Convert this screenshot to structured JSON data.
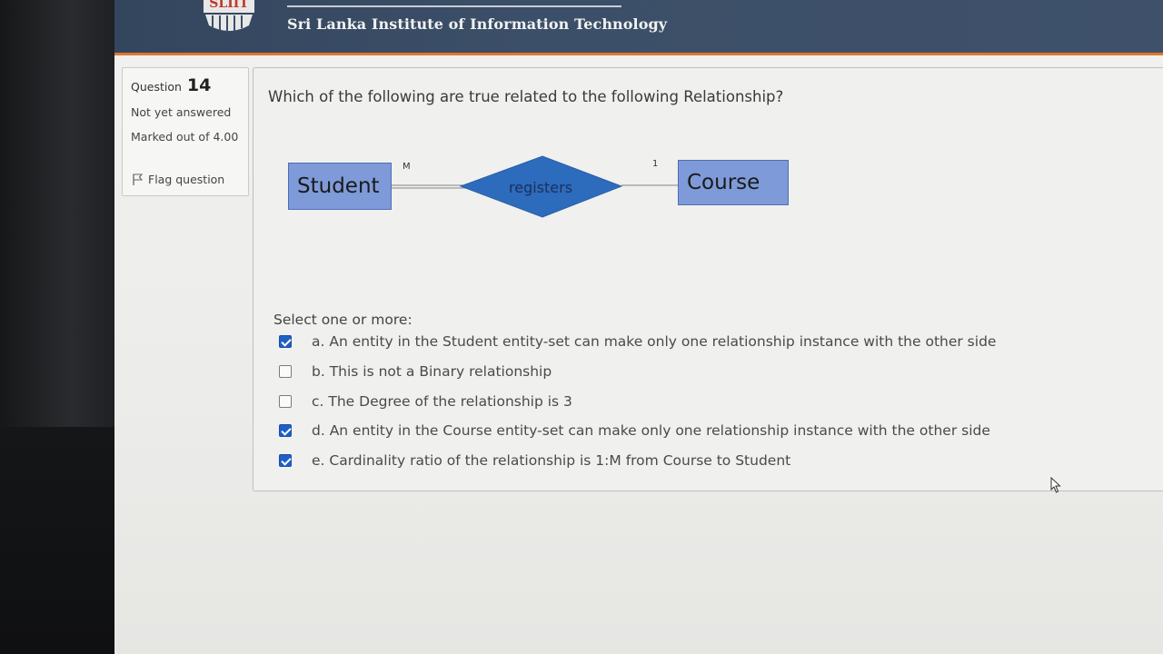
{
  "header": {
    "logo_text": "SLIIT",
    "site_name": "Sri Lanka Institute of Information Technology"
  },
  "info": {
    "question_label": "Question",
    "question_number": "14",
    "status": "Not yet answered",
    "marked": "Marked out of 4.00",
    "flag_label": "Flag question",
    "flag_icon": "flag-icon"
  },
  "question": {
    "text": "Which of the following are true related to the following Relationship?",
    "diagram": {
      "entity_left": "Student",
      "entity_right": "Course",
      "relationship": "registers",
      "cardinality_left": "M",
      "cardinality_right": "1",
      "entity_color": "#7e9ad8",
      "relationship_color": "#2d6bbd"
    },
    "prompt": "Select one or more:",
    "options": [
      {
        "label": "a. An entity in the Student entity-set can make only one relationship instance with the other side",
        "checked": true
      },
      {
        "label": "b. This is not a Binary relationship",
        "checked": false
      },
      {
        "label": "c. The Degree of the relationship is 3",
        "checked": false
      },
      {
        "label": "d. An entity in the Course entity-set can make only one relationship instance with the other side",
        "checked": true
      },
      {
        "label": "e. Cardinality ratio of the relationship is 1:M from Course to Student",
        "checked": true
      }
    ]
  },
  "colors": {
    "header_bg": "#3c4f68",
    "header_accent": "#e0762d",
    "checkbox_checked": "#1f5fc6"
  }
}
